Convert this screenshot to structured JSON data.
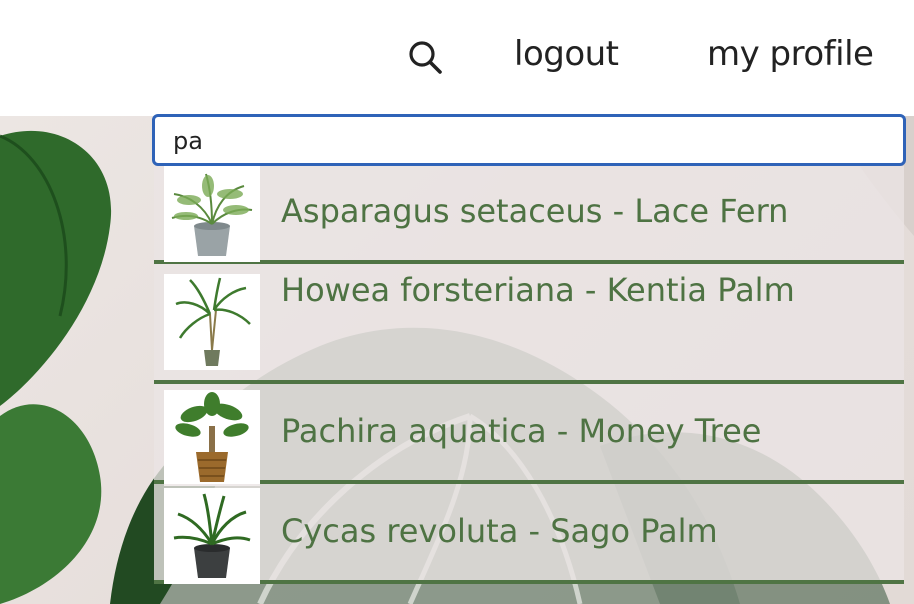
{
  "header": {
    "search_icon": "search-icon",
    "logout_label": "logout",
    "profile_label": "my profile"
  },
  "search": {
    "value": "pa",
    "border_color": "#2f63b8"
  },
  "results": [
    {
      "label": "Asparagus setaceus - Lace Fern",
      "thumbnail": "fern-plant-icon"
    },
    {
      "label": "Howea forsteriana - Kentia Palm",
      "thumbnail": "palm-plant-icon"
    },
    {
      "label": "Pachira aquatica - Money Tree",
      "thumbnail": "money-tree-icon"
    },
    {
      "label": "Cycas revoluta - Sago Palm",
      "thumbnail": "sago-palm-icon"
    }
  ],
  "colors": {
    "accent_green": "#4e7343",
    "divider_green": "#4f7444",
    "text_dark": "#222222"
  }
}
